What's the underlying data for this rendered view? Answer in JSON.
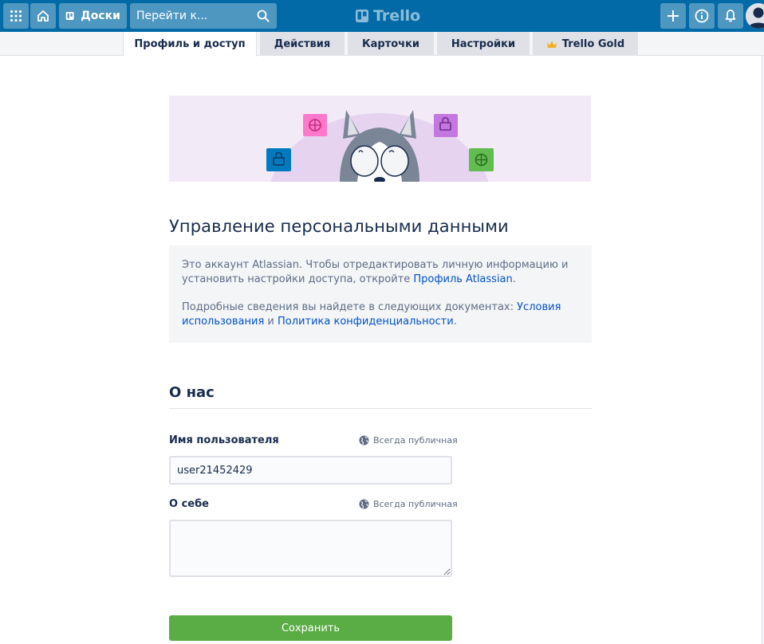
{
  "header": {
    "apps_icon": "grid-icon",
    "home_icon": "home-icon",
    "boards_label": "Доски",
    "search_placeholder": "Перейти к...",
    "logo_text": "Trello",
    "add_icon": "plus-icon",
    "info_icon": "info-icon",
    "notifications_icon": "bell-icon",
    "avatar_icon": "user-avatar-icon",
    "colors": {
      "bar": "#026aa7"
    }
  },
  "tabs": [
    {
      "label": "Профиль и доступ",
      "active": true
    },
    {
      "label": "Действия",
      "active": false
    },
    {
      "label": "Карточки",
      "active": false
    },
    {
      "label": "Настройки",
      "active": false
    },
    {
      "label": "Trello Gold",
      "active": false,
      "icon": "crown-icon"
    }
  ],
  "main": {
    "title": "Управление персональными данными",
    "info": {
      "p1_text": "Это аккаунт Atlassian. Чтобы отредактировать личную информацию и установить настройки доступа, откройте ",
      "p1_link": "Профиль Atlassian",
      "p1_end": ".",
      "p2_text": "Подробные сведения вы найдете в следующих документах: ",
      "p2_link1": "Условия использования",
      "p2_mid": " и ",
      "p2_link2": "Политика конфиденциальности",
      "p2_end": "."
    },
    "section_title": "О нас",
    "username": {
      "label": "Имя пользователя",
      "visibility": "Всегда публичная",
      "value": "user21452429"
    },
    "bio": {
      "label": "О себе",
      "visibility": "Всегда публичная",
      "value": ""
    },
    "save_label": "Сохранить",
    "save_color": "#5aac44"
  }
}
